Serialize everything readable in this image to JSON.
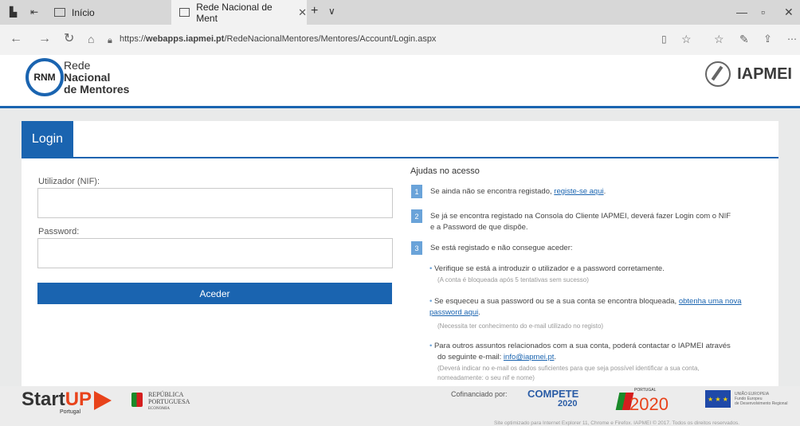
{
  "browser": {
    "tab1_label": "Início",
    "tab2_label": "Rede Nacional de Ment",
    "new_tab_symbol": "+",
    "tab_menu_symbol": "∨",
    "url_prefix": "https://",
    "url_domain": "webapps.iapmei.pt",
    "url_path": "/RedeNacionalMentores/Mentores/Account/Login.aspx"
  },
  "header": {
    "logo_initials": "RNM",
    "logo_line1": "Rede",
    "logo_line2": "Nacional",
    "logo_line3": "de Mentores",
    "partner_name": "IAPMEI"
  },
  "login": {
    "tab_label": "Login",
    "user_label": "Utilizador (NIF):",
    "user_value": "",
    "password_label": "Password:",
    "password_value": "",
    "submit_label": "Aceder"
  },
  "help": {
    "title": "Ajudas no acesso",
    "items": [
      {
        "num": "1",
        "text": "Se ainda não se encontra registado, ",
        "link": "registe-se aqui",
        "tail": "."
      },
      {
        "num": "2",
        "text": "Se já se encontra registado na Consola do Cliente IAPMEI, deverá fazer Login com o NIF",
        "text2": "e a Password de que dispõe."
      },
      {
        "num": "3",
        "text": "Se está registado e não consegue aceder:"
      }
    ],
    "bullets": [
      {
        "text": "Verifique se está a introduzir o utilizador e a password corretamente.",
        "note": "(A conta é bloqueada após 5 tentativas sem sucesso)"
      },
      {
        "text": "Se esqueceu a sua password ou se a sua conta se encontra bloqueada, ",
        "link": "obtenha uma nova password aqui",
        "tail": ".",
        "note": "(Necessita ter conhecimento do e-mail utilizado no registo)"
      },
      {
        "text": "Para outros assuntos relacionados com a sua conta, poderá contactar o IAPMEI através",
        "text2": "do seguinte e-mail: ",
        "link": "info@iapmei.pt",
        "tail": ".",
        "note": "(Deverá indicar no e-mail os dados suficientes para que seja possível identificar a sua conta,",
        "note2": "nomeadamente: o seu nif e nome)"
      }
    ]
  },
  "footer": {
    "startup_start": "Start",
    "startup_up": "UP",
    "startup_country": "Portugal",
    "republica_line1": "REPÚBLICA",
    "republica_line2": "PORTUGUESA",
    "republica_line3": "ECONOMIA",
    "cofinanced_label": "Cofinanciado por:",
    "compete_label": "COMPETE",
    "compete_year": "2020",
    "portugal_label": "PORTUGAL",
    "p2020_label": "2020",
    "eu_label": "UNIÃO EUROPEIA",
    "eu_line2": "Fundo Europeu",
    "eu_line3": "de Desenvolvimento Regional",
    "legal": "Site optimizado para Internet Explorer 11, Chrome e Firefox. IAPMEI © 2017. Todos os direitos reservados."
  },
  "colors": {
    "primary": "#1a64b0",
    "badge": "#6aa3d9",
    "accent": "#e8431b"
  }
}
